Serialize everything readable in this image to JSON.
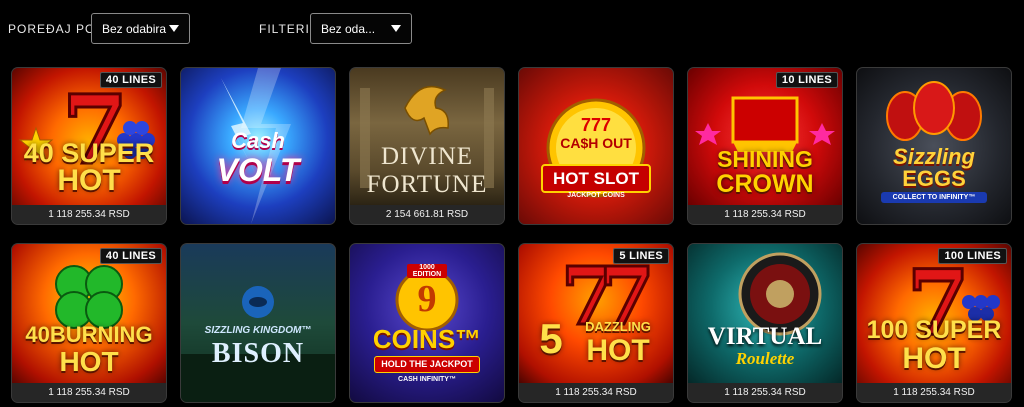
{
  "sort": {
    "label": "POREĐAJ PO",
    "value": "Bez odabira"
  },
  "filter": {
    "label": "FILTERI",
    "value": "Bez oda..."
  },
  "games": [
    {
      "title_a": "40 SUPER",
      "title_b": "HOT",
      "badge": "40 LINES",
      "jackpot": "1 118 255.34 RSD"
    },
    {
      "title_a": "Cash",
      "title_b": "VOLT",
      "badge": "",
      "jackpot": ""
    },
    {
      "title_a": "DIVINE",
      "title_b": "FORTUNE",
      "badge": "",
      "jackpot": "2 154 661.81 RSD"
    },
    {
      "title_a": "777",
      "title_b": "CA$H OUT",
      "title_c": "HOT SLOT",
      "title_d": "JACKPOT COINS",
      "badge": "",
      "jackpot": ""
    },
    {
      "title_a": "SHINING",
      "title_b": "CROWN",
      "badge": "10 LINES",
      "jackpot": "1 118 255.34 RSD"
    },
    {
      "title_a": "Sizzling",
      "title_b": "EGGS",
      "title_c": "COLLECT TO INFINITY™",
      "badge": "",
      "jackpot": ""
    },
    {
      "title_a": "40BURNING",
      "title_b": "HOT",
      "badge": "40 LINES",
      "jackpot": "1 118 255.34 RSD"
    },
    {
      "title_a": "SIZZLING KINGDOM™",
      "title_b": "BISON",
      "badge": "",
      "jackpot": ""
    },
    {
      "title_a": "9",
      "title_b": "COINS™",
      "title_c": "HOLD THE JACKPOT",
      "title_d": "1000 EDITION",
      "title_e": "CASH INFINITY™",
      "badge": "",
      "jackpot": ""
    },
    {
      "title_a": "5",
      "title_b": "DAZZLING",
      "title_c": "HOT",
      "badge": "5 LINES",
      "jackpot": "1 118 255.34 RSD"
    },
    {
      "title_a": "VIRTUAL",
      "title_b": "Roulette",
      "badge": "",
      "jackpot": "1 118 255.34 RSD"
    },
    {
      "title_a": "100 SUPER",
      "title_b": "HOT",
      "badge": "100 LINES",
      "jackpot": "1 118 255.34 RSD"
    }
  ],
  "colors": {
    "accent_red": "#d21b1b",
    "gold": "#ffc400",
    "tile_bg": "#262626"
  }
}
